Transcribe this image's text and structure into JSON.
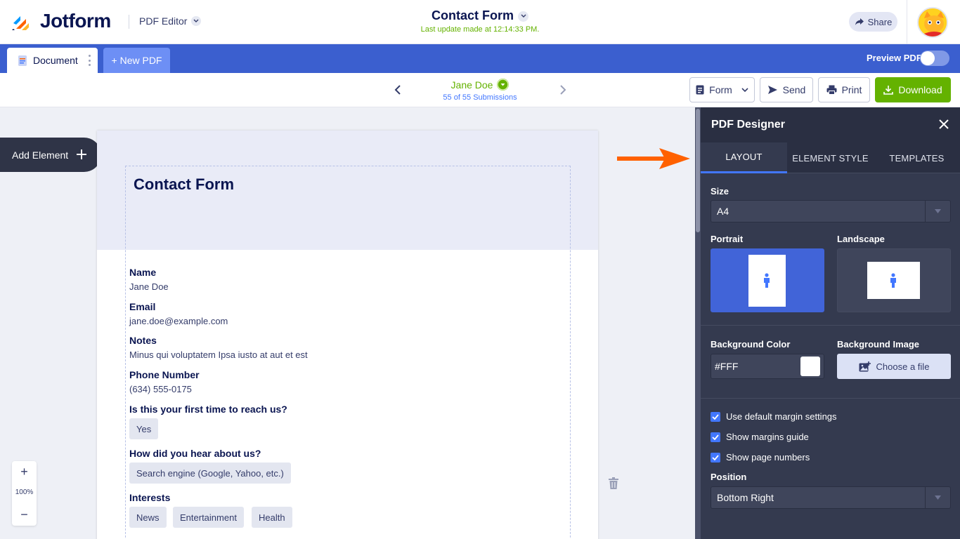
{
  "brand": {
    "name": "Jotform"
  },
  "header": {
    "app_name": "PDF Editor",
    "form_title": "Contact Form",
    "last_update": "Last update made at 12:14:33 PM.",
    "share_label": "Share"
  },
  "tabs": {
    "document_label": "Document",
    "new_pdf_label": "+ New PDF",
    "preview_label": "Preview PDF",
    "preview_on": false
  },
  "submission": {
    "name": "Jane Doe",
    "count": "55 of 55 Submissions"
  },
  "toolbar": {
    "form_label": "Form",
    "send_label": "Send",
    "print_label": "Print",
    "download_label": "Download"
  },
  "add_element_label": "Add Element",
  "zoom": {
    "plus": "+",
    "level": "100%",
    "minus": "−"
  },
  "document": {
    "title": "Contact Form",
    "fields": [
      {
        "label": "Name",
        "value": "Jane Doe"
      },
      {
        "label": "Email",
        "value": "jane.doe@example.com"
      },
      {
        "label": "Notes",
        "value": "Minus qui voluptatem Ipsa iusto at aut et est"
      },
      {
        "label": "Phone Number",
        "value": "(634) 555-0175"
      }
    ],
    "q_first_time": {
      "label": "Is this your first time to reach us?",
      "answer": "Yes"
    },
    "q_hear": {
      "label": "How did you hear about us?",
      "answer": "Search engine (Google, Yahoo, etc.)"
    },
    "q_interests": {
      "label": "Interests",
      "answers": [
        "News",
        "Entertainment",
        "Health"
      ]
    }
  },
  "panel": {
    "title": "PDF Designer",
    "tabs": [
      "LAYOUT",
      "ELEMENT STYLE",
      "TEMPLATES"
    ],
    "active_tab": "LAYOUT",
    "size_label": "Size",
    "size_value": "A4",
    "portrait_label": "Portrait",
    "landscape_label": "Landscape",
    "bg_color_label": "Background Color",
    "bg_color_value": "#FFF",
    "bg_image_label": "Background Image",
    "choose_file_label": "Choose a file",
    "checkboxes": [
      {
        "label": "Use default margin settings",
        "checked": true
      },
      {
        "label": "Show margins guide",
        "checked": true
      },
      {
        "label": "Show page numbers",
        "checked": true
      }
    ],
    "position_label": "Position",
    "position_value": "Bottom Right"
  },
  "colors": {
    "accent_blue": "#3b5fcf",
    "green": "#64b200",
    "panel_bg": "#343a4f",
    "annotation_arrow": "#ff6100"
  },
  "icons": {
    "logo": "jotform-logo-icon",
    "share": "share-arrow-icon",
    "form": "form-icon",
    "send": "send-icon",
    "print": "printer-icon",
    "download": "download-icon",
    "trash": "trash-icon",
    "close": "close-icon",
    "image": "image-add-icon"
  }
}
